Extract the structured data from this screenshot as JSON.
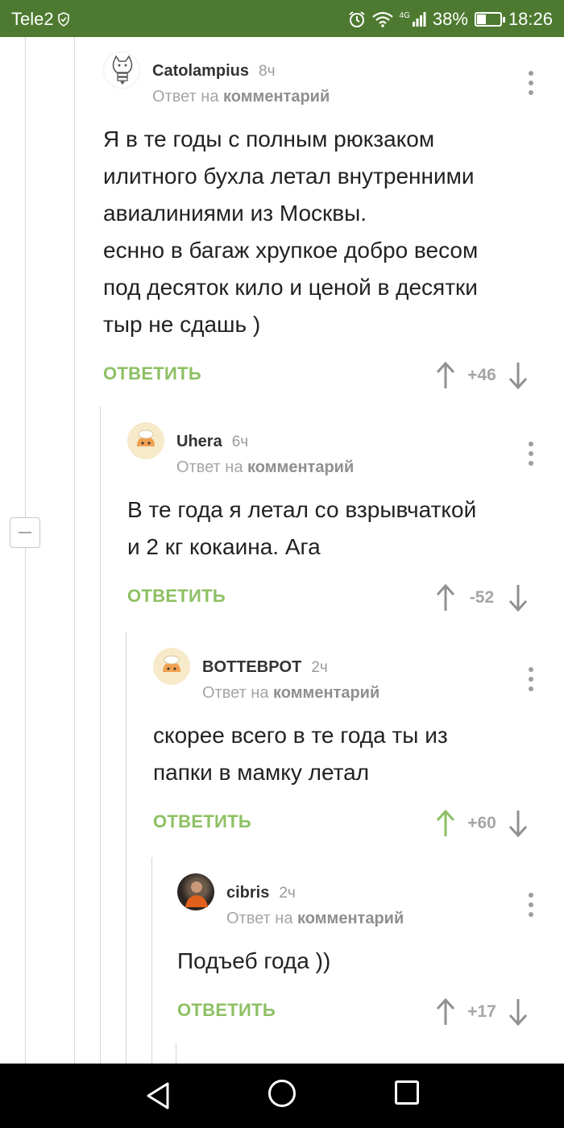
{
  "status_bar": {
    "carrier": "Tele2",
    "network": "4G",
    "battery": "38%",
    "battery_level": 0.38,
    "time": "18:26"
  },
  "ui": {
    "reply_prefix": "Ответ на",
    "reply_target": "комментарий",
    "answer_label": "ОТВЕТИТЬ"
  },
  "colors": {
    "status_bar": "#4d7a30",
    "accent_green": "#8dc063",
    "muted": "#a5a5a5"
  },
  "comments": [
    {
      "author": "Catolampius",
      "time": "8ч",
      "avatar": "cat-lightbulb-avatar",
      "lines": [
        "Я в те годы с полным рюкзаком",
        "илитного бухла летал внутренними",
        "авиалиниями из Москвы.",
        "еснно в багаж хрупкое добро весом",
        "под десяток кило и ценой в десятки",
        "тыр не сдашь )"
      ],
      "score": "+46",
      "upvoted": false
    },
    {
      "author": "Uhera",
      "time": "6ч",
      "avatar": "chef-avatar",
      "lines": [
        "В те года я летал со взрывчаткой",
        "и 2 кг кокаина. Ага"
      ],
      "score": "-52",
      "upvoted": false
    },
    {
      "author": "BOTTEBPOT",
      "time": "2ч",
      "avatar": "chef-avatar",
      "lines": [
        "скорее всего в те года ты из",
        "папки в мамку летал"
      ],
      "score": "+60",
      "upvoted": true
    },
    {
      "author": "cibris",
      "time": "2ч",
      "avatar": "photo-avatar",
      "lines": [
        "Подъеб года ))"
      ],
      "score": "+17",
      "upvoted": false
    }
  ]
}
